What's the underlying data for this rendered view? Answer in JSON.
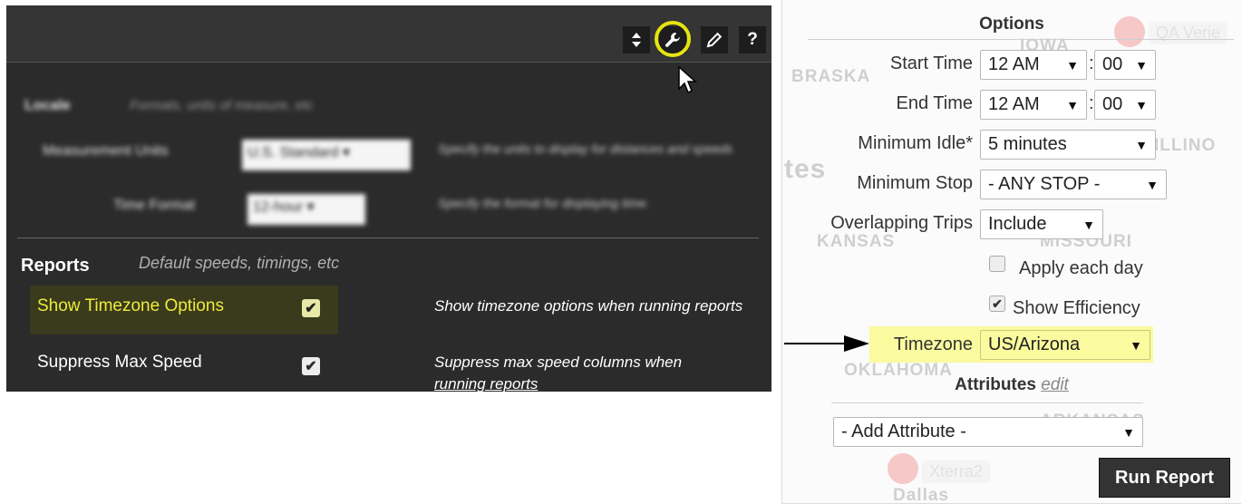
{
  "settings_panel": {
    "toolbar": {
      "sort_icon": "sort-arrows-icon",
      "wrench_icon": "wrench-icon",
      "pencil_icon": "pencil-icon",
      "help_label": "?"
    },
    "locale_section": {
      "title": "Locale",
      "subtitle": "Formats, units of measure, etc",
      "measurement_units_label": "Measurement Units",
      "measurement_units_value": "U.S. Standard",
      "measurement_units_help": "Specify the units to display for distances and speeds",
      "time_format_label": "Time Format",
      "time_format_value": "12-hour",
      "time_format_help": "Specify the format for displaying time."
    },
    "reports_section": {
      "title": "Reports",
      "subtitle": "Default speeds, timings, etc",
      "show_timezone_label": "Show Timezone Options",
      "show_timezone_checked": true,
      "show_timezone_help": "Show timezone options when running reports",
      "suppress_max_speed_label": "Suppress Max Speed",
      "suppress_max_speed_checked": true,
      "suppress_max_speed_help_1": "Suppress max speed columns when",
      "suppress_max_speed_help_2": "running reports"
    },
    "highlight_color": "#e5e50f"
  },
  "options_panel": {
    "title": "Options",
    "start_time_label": "Start Time",
    "start_hour": "12 AM",
    "start_minute": "00",
    "end_time_label": "End Time",
    "end_hour": "12 AM",
    "end_minute": "00",
    "minimum_idle_label": "Minimum Idle*",
    "minimum_idle_value": "5 minutes",
    "minimum_stop_label": "Minimum Stop",
    "minimum_stop_value": "- ANY STOP -",
    "overlapping_trips_label": "Overlapping Trips",
    "overlapping_trips_value": "Include",
    "apply_each_day_label": "Apply each day",
    "apply_each_day_checked": false,
    "show_efficiency_label": "Show Efficiency",
    "show_efficiency_checked": true,
    "timezone_label": "Timezone",
    "timezone_value": "US/Arizona",
    "attributes_title": "Attributes",
    "attributes_edit": "edit",
    "add_attribute_value": "- Add Attribute -",
    "run_report_label": "Run Report",
    "colon": ":",
    "dropdown_arrow": "▼",
    "map_labels": [
      "QA Verie",
      "IOWA",
      "BRASKA",
      "ILLINO",
      "tes",
      "MISSOURI",
      "KANSAS",
      "OKLAHOMA",
      "ARKANSAS",
      "Xterra2",
      "Dallas"
    ]
  }
}
